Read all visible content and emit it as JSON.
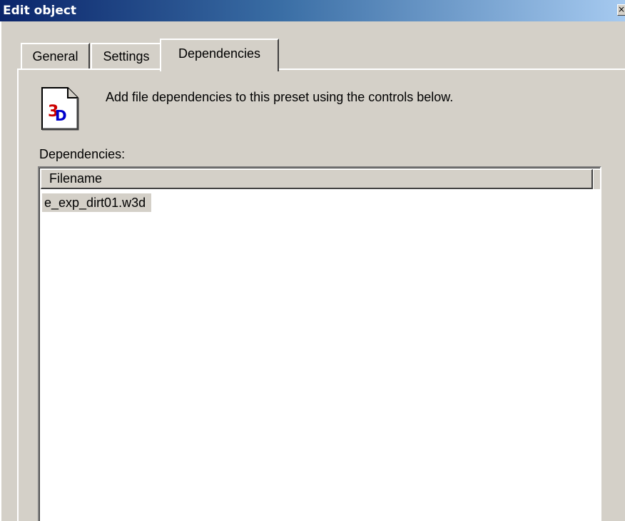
{
  "window": {
    "title": "Edit object",
    "close_glyph": "×"
  },
  "tabs": [
    {
      "label": "General",
      "selected": false
    },
    {
      "label": "Settings",
      "selected": false
    },
    {
      "label": "Dependencies",
      "selected": true
    }
  ],
  "dependencies_page": {
    "icon": "3d-file-icon",
    "instruction": "Add file dependencies to this preset using the controls below.",
    "list_label": "Dependencies:",
    "list": {
      "columns": [
        "Filename"
      ],
      "rows": [
        {
          "filename": "e_exp_dirt01.w3d"
        }
      ]
    }
  }
}
